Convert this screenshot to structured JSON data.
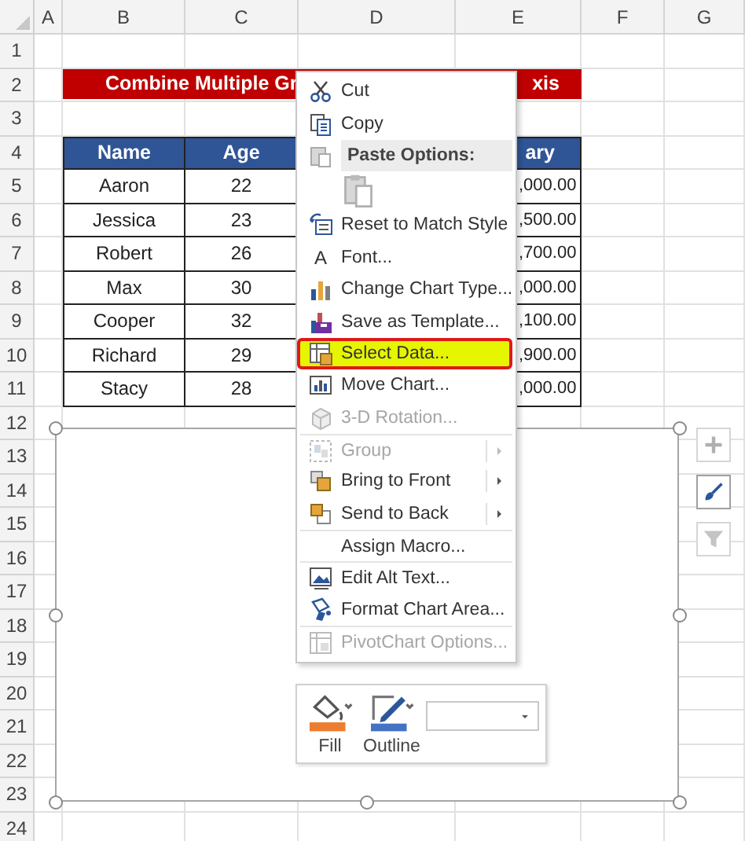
{
  "columns": [
    "A",
    "B",
    "C",
    "D",
    "E",
    "F",
    "G"
  ],
  "row_numbers": [
    "1",
    "2",
    "3",
    "4",
    "5",
    "6",
    "7",
    "8",
    "9",
    "10",
    "11",
    "12",
    "13",
    "14",
    "15",
    "16",
    "17",
    "18",
    "19",
    "20",
    "21",
    "22",
    "23",
    "24"
  ],
  "title": {
    "visible_start": "Combine Multiple Gr",
    "visible_end": "xis"
  },
  "table": {
    "headers": [
      "Name",
      "Age",
      "ary"
    ],
    "rows": [
      {
        "name": "Aaron",
        "age": "22",
        "salary": ",000.00"
      },
      {
        "name": "Jessica",
        "age": "23",
        "salary": ",500.00"
      },
      {
        "name": "Robert",
        "age": "26",
        "salary": ",700.00"
      },
      {
        "name": "Max",
        "age": "30",
        "salary": ",000.00"
      },
      {
        "name": "Cooper",
        "age": "32",
        "salary": ",100.00"
      },
      {
        "name": "Richard",
        "age": "29",
        "salary": ",900.00"
      },
      {
        "name": "Stacy",
        "age": "28",
        "salary": ",000.00"
      }
    ]
  },
  "context_menu": {
    "items": [
      {
        "kind": "item",
        "label": "Cut",
        "disabled": false,
        "selected": false,
        "submenu": false,
        "separator_before": false
      },
      {
        "kind": "item",
        "label": "Copy",
        "disabled": false,
        "selected": false,
        "submenu": false,
        "separator_before": false
      },
      {
        "kind": "header",
        "label": "Paste Options:"
      },
      {
        "kind": "paste"
      },
      {
        "kind": "item",
        "label": "Reset to Match Style",
        "disabled": false,
        "selected": false,
        "submenu": false,
        "separator_before": false
      },
      {
        "kind": "item",
        "label": "Font...",
        "glyph": "A",
        "disabled": false,
        "selected": false,
        "submenu": false,
        "separator_before": false
      },
      {
        "kind": "item",
        "label": "Change Chart Type...",
        "disabled": false,
        "selected": false,
        "submenu": false,
        "separator_before": false
      },
      {
        "kind": "item",
        "label": "Save as Template...",
        "disabled": false,
        "selected": false,
        "submenu": false,
        "separator_before": false
      },
      {
        "kind": "item",
        "label": "Select Data...",
        "disabled": false,
        "selected": true,
        "submenu": false,
        "separator_before": false
      },
      {
        "kind": "item",
        "label": "Move Chart...",
        "disabled": false,
        "selected": false,
        "submenu": false,
        "separator_before": false
      },
      {
        "kind": "item",
        "label": "3-D Rotation...",
        "disabled": true,
        "selected": false,
        "submenu": false,
        "separator_before": false
      },
      {
        "kind": "item",
        "label": "Group",
        "disabled": true,
        "selected": false,
        "submenu": true,
        "separator_before": true
      },
      {
        "kind": "item",
        "label": "Bring to Front",
        "disabled": false,
        "selected": false,
        "submenu": true,
        "separator_before": false
      },
      {
        "kind": "item",
        "label": "Send to Back",
        "disabled": false,
        "selected": false,
        "submenu": true,
        "separator_before": false
      },
      {
        "kind": "item",
        "label": "Assign Macro...",
        "disabled": false,
        "selected": false,
        "submenu": false,
        "separator_before": true
      },
      {
        "kind": "item",
        "label": "Edit Alt Text...",
        "disabled": false,
        "selected": false,
        "submenu": false,
        "separator_before": true
      },
      {
        "kind": "item",
        "label": "Format Chart Area...",
        "disabled": false,
        "selected": false,
        "submenu": false,
        "separator_before": false
      },
      {
        "kind": "item",
        "label": "PivotChart Options...",
        "disabled": true,
        "selected": false,
        "submenu": false,
        "separator_before": true
      }
    ]
  },
  "format_toolbar": {
    "buttons": [
      {
        "label": "Fill"
      },
      {
        "label": "Outline"
      }
    ]
  }
}
